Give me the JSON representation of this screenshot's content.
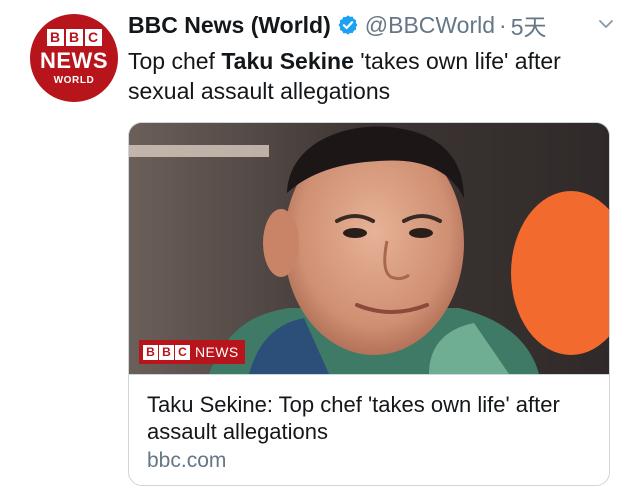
{
  "account": {
    "display_name": "BBC News (World)",
    "handle": "@BBCWorld",
    "separator": "·",
    "timestamp": "5天",
    "verified": true,
    "avatar": {
      "blocks": [
        "B",
        "B",
        "C"
      ],
      "line1": "NEWS",
      "line2": "WORLD"
    }
  },
  "tweet": {
    "text_parts": [
      "Top chef ",
      "Taku Sekine",
      " 'takes own life' after sexual assault allegations"
    ]
  },
  "card": {
    "badge_blocks": [
      "B",
      "B",
      "C"
    ],
    "badge_label": "NEWS",
    "title": "Taku Sekine: Top chef 'takes own life' after assault allegations",
    "domain": "bbc.com"
  },
  "colors": {
    "brand_red": "#b8141b",
    "verified_blue": "#1da1f2",
    "muted": "#657786",
    "accent_orange": "#f26a2e"
  },
  "icons": {
    "verified": "verified-badge-icon",
    "menu": "chevron-down-icon"
  }
}
